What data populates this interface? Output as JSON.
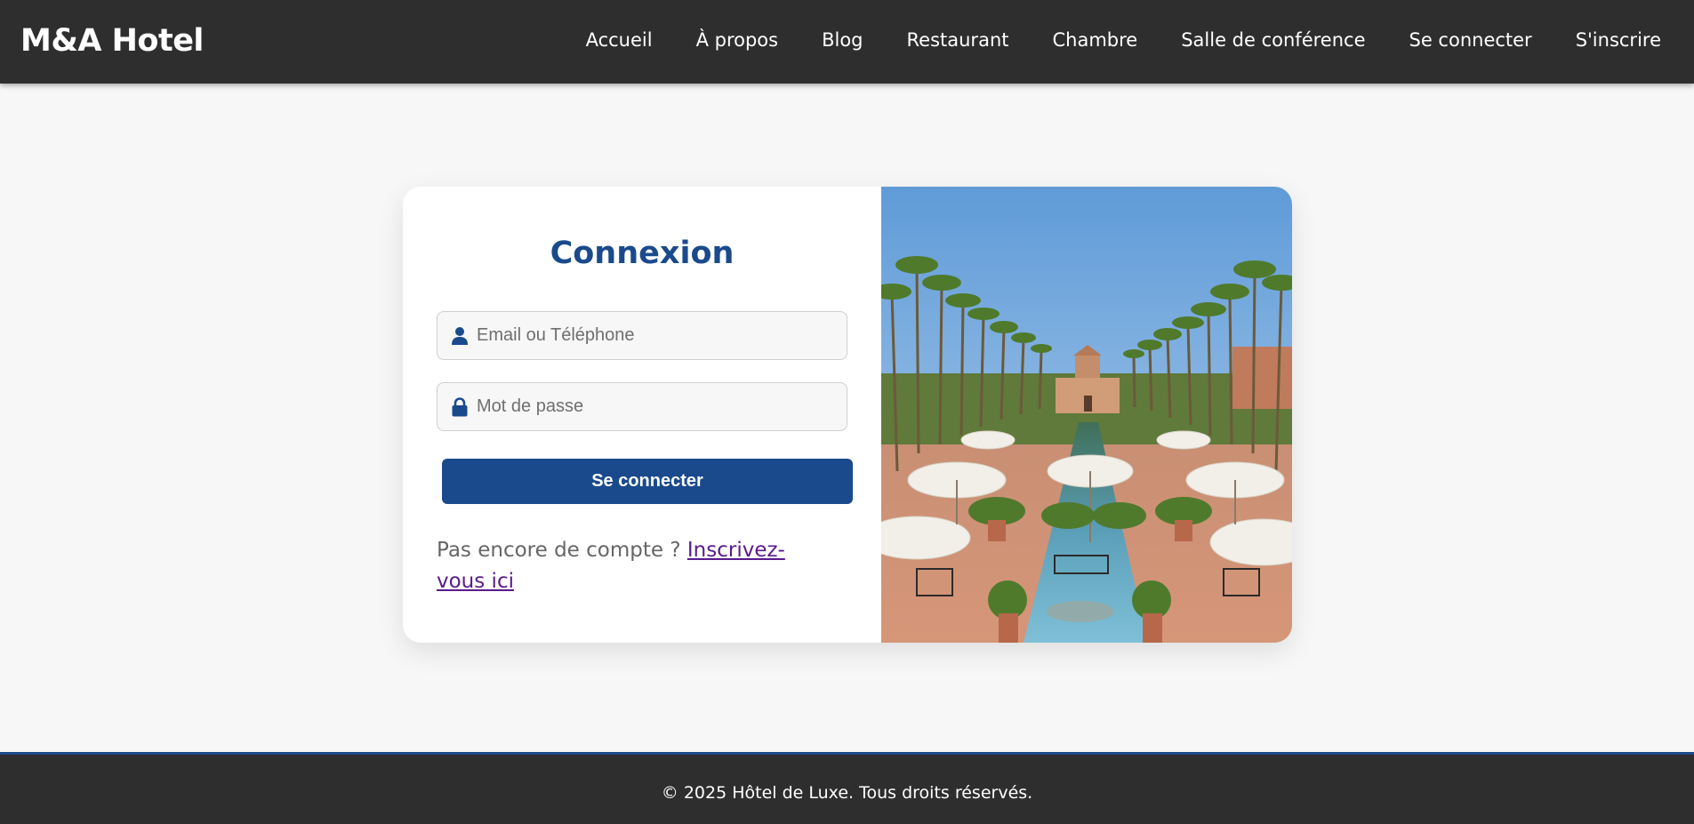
{
  "header": {
    "brand": "M&A Hotel",
    "nav": [
      {
        "label": "Accueil"
      },
      {
        "label": "À propos"
      },
      {
        "label": "Blog"
      },
      {
        "label": "Restaurant"
      },
      {
        "label": "Chambre"
      },
      {
        "label": "Salle de conférence"
      },
      {
        "label": "Se connecter"
      },
      {
        "label": "S'inscrire"
      }
    ]
  },
  "login": {
    "title": "Connexion",
    "email_placeholder": "Email ou Téléphone",
    "email_value": "",
    "password_placeholder": "Mot de passe",
    "password_value": "",
    "email_icon": "user-icon",
    "password_icon": "lock-icon",
    "submit_label": "Se connecter",
    "signup_prompt": "Pas encore de compte ? ",
    "signup_link": "Inscrivez-vous ici"
  },
  "footer": {
    "copyright": "© 2025 Hôtel de Luxe. Tous droits réservés."
  },
  "colors": {
    "header_bg": "#2e2e2e",
    "accent": "#1a4a8c",
    "page_bg": "#f7f7f7",
    "link_visited": "#5b1a8c"
  }
}
